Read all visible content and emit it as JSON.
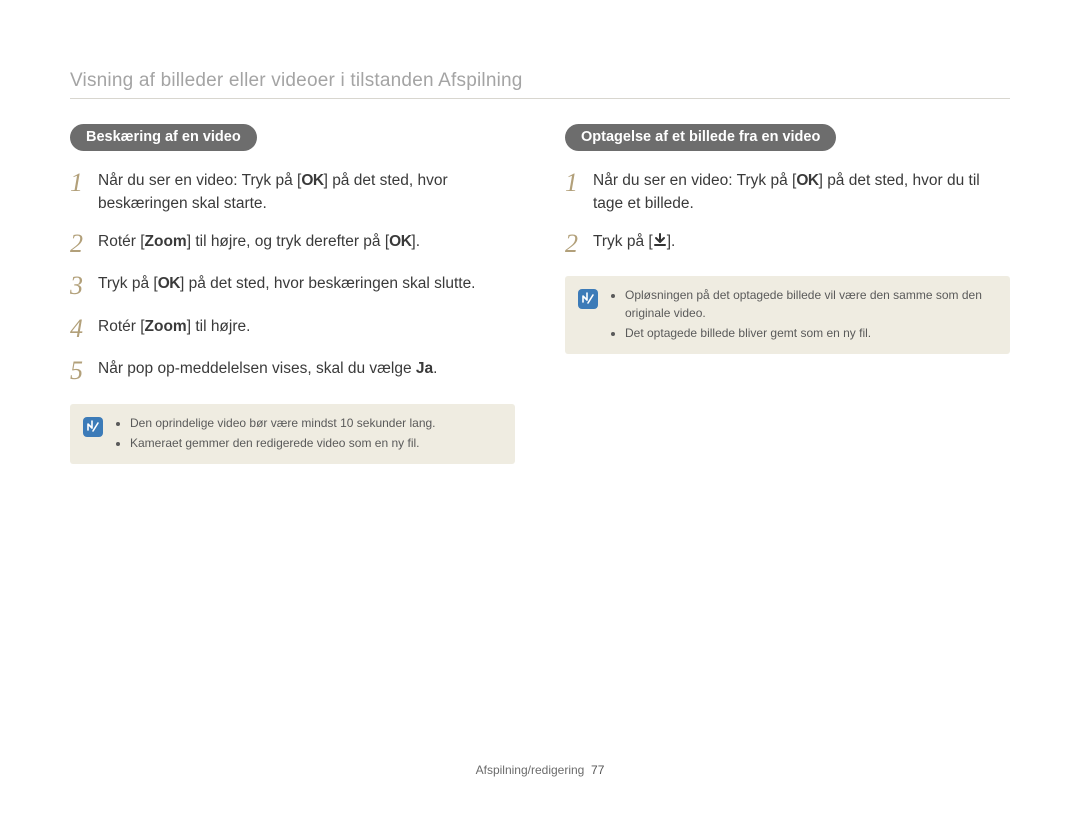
{
  "page_title": "Visning af billeder eller videoer i tilstanden Afspilning",
  "left": {
    "heading": "Beskæring af en video",
    "steps": {
      "s1a": "Når du ser en video: Tryk på [",
      "s1_ok": "OK",
      "s1b": "] på det sted, hvor beskæringen skal starte.",
      "s2a": "Rotér [",
      "s2_zoom": "Zoom",
      "s2b": "] til højre, og tryk derefter på [",
      "s2_ok": "OK",
      "s2c": "].",
      "s3a": "Tryk på [",
      "s3_ok": "OK",
      "s3b": "] på det sted, hvor beskæringen skal slutte.",
      "s4a": "Rotér [",
      "s4_zoom": "Zoom",
      "s4b": "] til højre.",
      "s5a": "Når pop op-meddelelsen vises, skal du vælge ",
      "s5_ja": "Ja",
      "s5b": "."
    },
    "notes": [
      "Den oprindelige video bør være mindst 10 sekunder lang.",
      "Kameraet gemmer den redigerede video som en ny fil."
    ]
  },
  "right": {
    "heading": "Optagelse af et billede fra en video",
    "steps": {
      "s1a": "Når du ser en video: Tryk på [",
      "s1_ok": "OK",
      "s1b": "] på det sted, hvor du til tage et billede.",
      "s2a": "Tryk på [",
      "s2b": "]."
    },
    "notes": [
      "Opløsningen på det optagede billede vil være den samme som den originale video.",
      "Det optagede billede bliver gemt som en ny fil."
    ]
  },
  "footer": {
    "section": "Afspilning/redigering",
    "page": "77"
  },
  "step_numbers": [
    "1",
    "2",
    "3",
    "4",
    "5"
  ]
}
